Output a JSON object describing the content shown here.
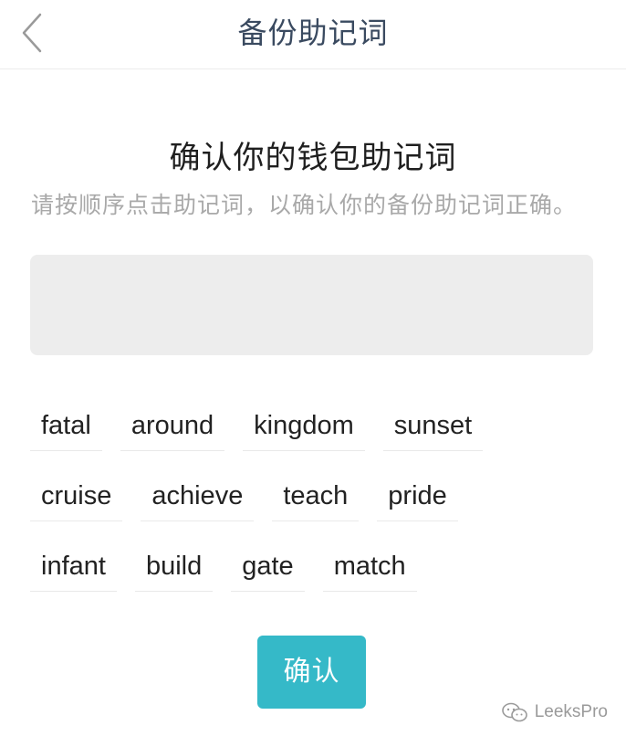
{
  "navbar": {
    "title": "备份助记词",
    "back_icon": "chevron-left-icon"
  },
  "main": {
    "heading": "确认你的钱包助记词",
    "subtitle": "请按顺序点击助记词，以确认你的备份助记词正确。",
    "words": [
      [
        "fatal",
        "around",
        "kingdom",
        "sunset"
      ],
      [
        "cruise",
        "achieve",
        "teach",
        "pride"
      ],
      [
        "infant",
        "build",
        "gate",
        "match"
      ]
    ],
    "confirm_label": "确认"
  },
  "watermark": {
    "text": "LeeksPro",
    "icon": "wechat-icon"
  },
  "colors": {
    "accent": "#35b9c8",
    "title": "#3a4a60",
    "subtitle": "#a9a9a9",
    "selection_bg": "#ededed"
  }
}
